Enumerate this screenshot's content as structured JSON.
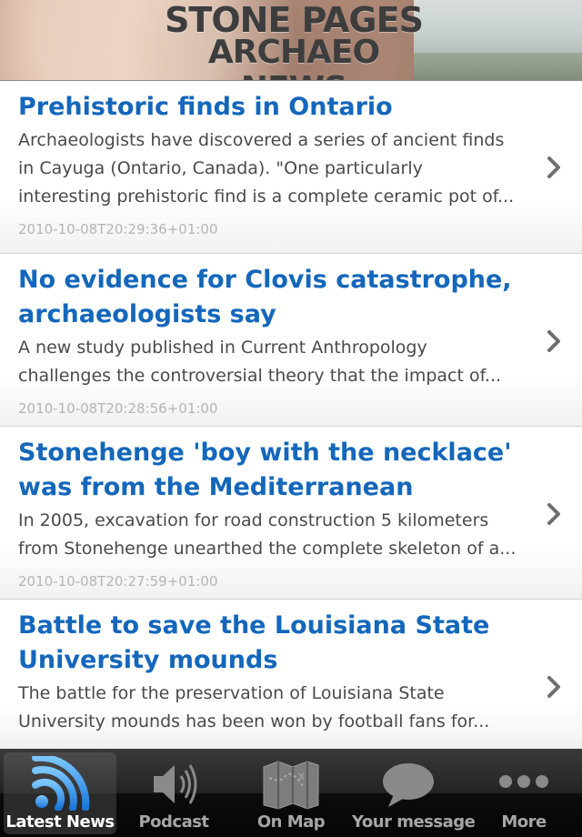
{
  "header": {
    "title_line1": "STONE PAGES",
    "title_line2": "ARCHAEO NEWS"
  },
  "news": [
    {
      "title": "Prehistoric finds in Ontario",
      "summary": "Archaeologists have discovered a series of ancient finds in Cayuga (Ontario, Canada). \"One particularly interesting prehistoric find is a complete ceramic pot of...",
      "date": "2010-10-08T20:29:36+01:00"
    },
    {
      "title": "No evidence for Clovis catastrophe, archaeologists say",
      "summary": "A new study published in Current Anthropology challenges the controversial theory that the impact of...",
      "date": "2010-10-08T20:28:56+01:00"
    },
    {
      "title": "Stonehenge 'boy with the necklace' was from the Mediterranean",
      "summary": "In 2005, excavation for road construction 5 kilometers from Stonehenge unearthed the complete skeleton of a...",
      "date": "2010-10-08T20:27:59+01:00"
    },
    {
      "title": "Battle to save the Louisiana State University mounds",
      "summary": "The battle for the preservation of Louisiana State University mounds has been won by football fans for...",
      "date": ""
    }
  ],
  "tabs": [
    {
      "label": "Latest News",
      "icon": "rss-icon",
      "active": true
    },
    {
      "label": "Podcast",
      "icon": "speaker-icon",
      "active": false
    },
    {
      "label": "On Map",
      "icon": "map-icon",
      "active": false
    },
    {
      "label": "Your message",
      "icon": "speech-bubble-icon",
      "active": false
    },
    {
      "label": "More",
      "icon": "more-dots-icon",
      "active": false
    }
  ],
  "colors": {
    "title_blue": "#1467bb",
    "tabbar_bg": "#0c0c0c",
    "active_label": "#ffffff",
    "inactive_label": "#a6a6a6"
  }
}
